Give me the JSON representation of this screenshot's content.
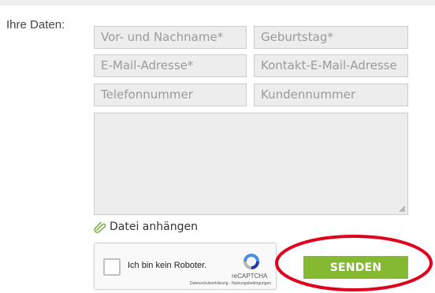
{
  "form": {
    "label": "Ihre Daten:",
    "fields": {
      "name": {
        "placeholder": "Vor- und Nachname*"
      },
      "birthday": {
        "placeholder": "Geburtstag*"
      },
      "email": {
        "placeholder": "E-Mail-Adresse*"
      },
      "contact_email": {
        "placeholder": "Kontakt-E-Mail-Adresse"
      },
      "phone": {
        "placeholder": "Telefonnummer"
      },
      "customer_number": {
        "placeholder": "Kundennummer"
      },
      "message": {
        "placeholder": ""
      }
    },
    "attach_label": "Datei anhängen",
    "attach_icon": "paperclip-icon",
    "submit_label": "SENDEN"
  },
  "captcha": {
    "label": "Ich bin kein Roboter.",
    "brand": "reCAPTCHA",
    "links": "Datenschutzerklärung - Nutzungsbedingungen",
    "logo_icon": "recaptcha-logo-icon"
  },
  "colors": {
    "button": "#86b932",
    "field_bg": "#ededed",
    "highlight": "#e0001b",
    "attach_icon": "#7cb342"
  }
}
